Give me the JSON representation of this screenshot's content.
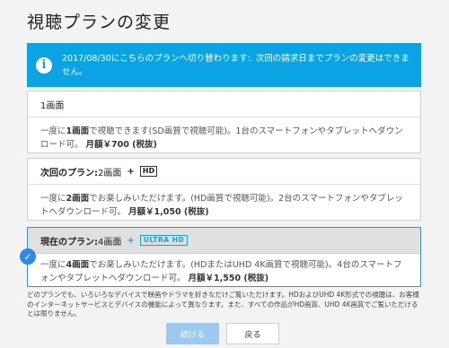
{
  "page": {
    "title": "視聴プランの変更"
  },
  "info": {
    "icon": "i",
    "message": "2017/08/30にこちらのプランへ切り替わります:. 次回の請求日までプランの変更はできません。"
  },
  "plans": [
    {
      "name": "1画面",
      "desc_a": "一度に",
      "desc_b": "1画面",
      "desc_c": "で視聴できます(SD画質で視聴可能)。1台のスマートフォンやタブレットへダウンロード可。",
      "price": "月額￥700 (税抜)"
    },
    {
      "prefix": "次回のプラン:",
      "name": "2画面",
      "plus": "+",
      "badge": "HD",
      "desc_a": "一度に",
      "desc_b": "2画面",
      "desc_c": "でお楽しみいただけます。(HD画質で視聴可能)。2台のスマートフォンやタブレットへダウンロード可。",
      "price": "月額￥1,050 (税抜)"
    },
    {
      "prefix": "現在のプラン:",
      "name": "4画面",
      "plus": "+",
      "badge": "ULTRA HD",
      "desc_a": "一度に",
      "desc_b": "4画面",
      "desc_c": "でお楽しみいただけます。(HDまたはUHD 4K画質で視聴可能)。4台のスマートフォンやタブレットへダウンロード可。",
      "price": "月額￥1,550 (税抜)",
      "check": "✓"
    }
  ],
  "notice": "どのプランでも、いろいろなデバイスで映画やドラマを好きなだけご覧いただけます。HDおよびUHD 4K形式での視聴は、お客様のインターネットサービスとデバイスの機能によって異なります。また、すべての作品がHD画質、UHD 4K画質でご覧いただけるとは限りません。",
  "buttons": {
    "continue": "続ける",
    "back": "戻る"
  },
  "colors": {
    "accent": "#0aa3e3",
    "selected_border": "#3b8ee0",
    "check": "#2f87e8"
  }
}
